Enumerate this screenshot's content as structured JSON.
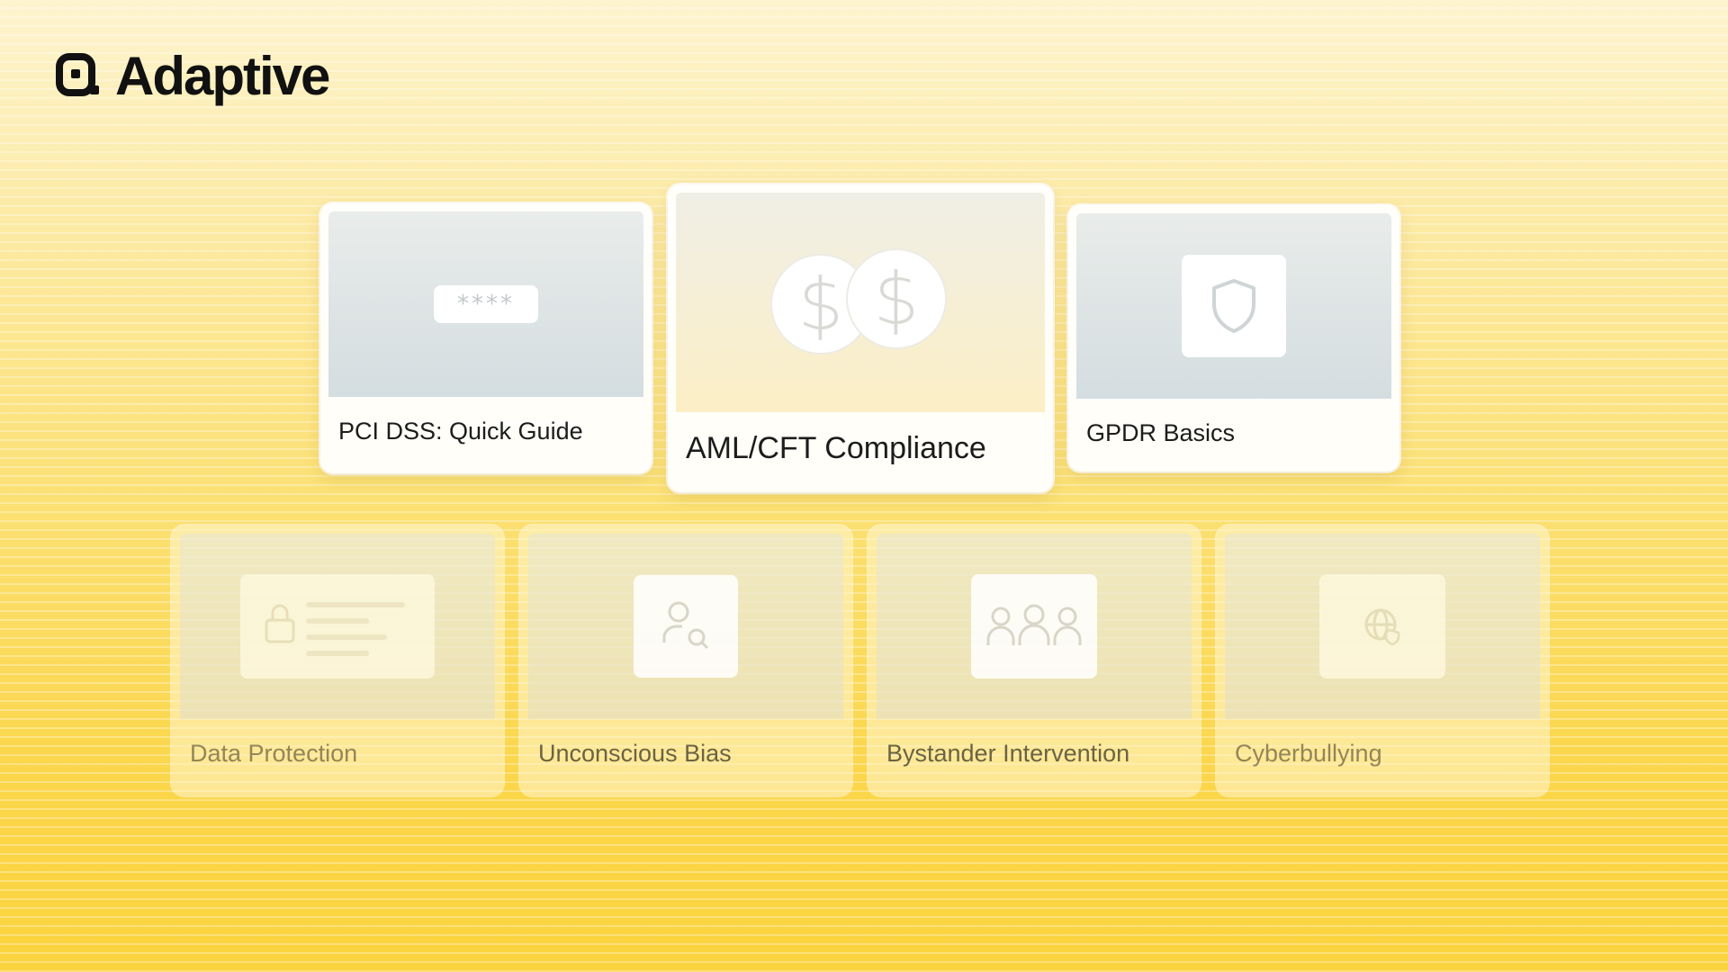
{
  "brand": {
    "name": "Adaptive",
    "logo_icon": "adaptive-logo-icon"
  },
  "featured_courses": [
    {
      "title": "PCI DSS: Quick Guide",
      "icon": "password-field-icon",
      "icon_text": "****"
    },
    {
      "title": "AML/CFT Compliance",
      "icon": "dollar-coins-icon",
      "icon_text": "$"
    },
    {
      "title": "GPDR Basics",
      "icon": "shield-icon"
    }
  ],
  "more_courses": [
    {
      "title": "Data Protection",
      "icon": "locked-document-icon"
    },
    {
      "title": "Unconscious Bias",
      "icon": "person-search-icon"
    },
    {
      "title": "Bystander Intervention",
      "icon": "group-people-icon"
    },
    {
      "title": "Cyberbullying",
      "icon": "globe-shield-icon"
    }
  ],
  "colors": {
    "background_top": "#fdf4cf",
    "background_bottom": "#fbd33e",
    "text_dark": "#1c1c1c"
  }
}
